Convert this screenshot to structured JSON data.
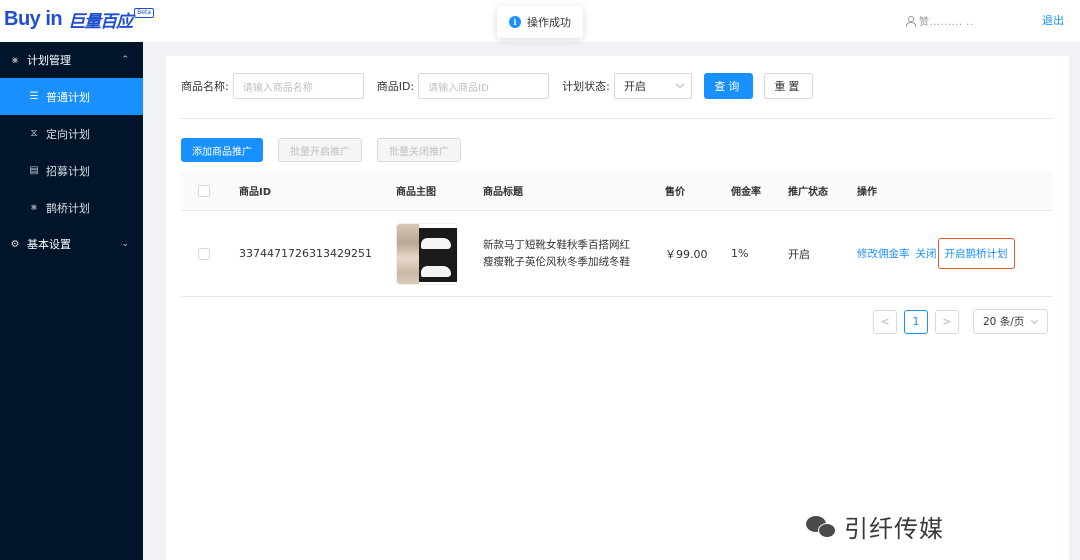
{
  "header": {
    "logo_en": "Buy in",
    "logo_cn": "巨量百应",
    "logo_badge": "Beta",
    "toast": "操作成功",
    "user_name": "赞.........   ..",
    "logout": "退出"
  },
  "sidebar": {
    "group_plan": "计划管理",
    "items": [
      {
        "label": "普通计划",
        "icon": "list-icon",
        "active": true
      },
      {
        "label": "定向计划",
        "icon": "hourglass-icon",
        "active": false
      },
      {
        "label": "招募计划",
        "icon": "recruit-icon",
        "active": false
      },
      {
        "label": "鹊桥计划",
        "icon": "bridge-icon",
        "active": false
      }
    ],
    "group_settings": "基本设置"
  },
  "filter": {
    "name_label": "商品名称:",
    "name_placeholder": "请输入商品名称",
    "id_label": "商品ID:",
    "id_placeholder": "请输入商品ID",
    "status_label": "计划状态:",
    "status_value": "开启",
    "search": "查询",
    "reset": "重置"
  },
  "actions": {
    "add": "添加商品推广",
    "batch_open": "批量开启推广",
    "batch_close": "批量关闭推广"
  },
  "table": {
    "headers": {
      "id": "商品ID",
      "image": "商品主图",
      "title": "商品标题",
      "price": "售价",
      "commission": "佣金率",
      "status": "推广状态",
      "ops": "操作"
    },
    "rows": [
      {
        "id": "3374471726313429251",
        "title_line1": "新款马丁短靴女鞋秋季百搭网红",
        "title_line2": "瘦瘦靴子英伦风秋冬季加绒冬鞋",
        "price": "￥99.00",
        "commission": "1%",
        "status": "开启",
        "op_modify": "修改佣金率",
        "op_close": "关闭",
        "op_bridge": "开启鹊桥计划"
      }
    ]
  },
  "pagination": {
    "prev": "<",
    "current": "1",
    "next": ">",
    "page_size": "20 条/页"
  },
  "watermark": {
    "text": "引纤传媒"
  },
  "colors": {
    "primary": "#1890ff",
    "sidebar_bg": "#001529",
    "highlight_border": "#e05a2b",
    "logo": "#1f4fd1"
  }
}
